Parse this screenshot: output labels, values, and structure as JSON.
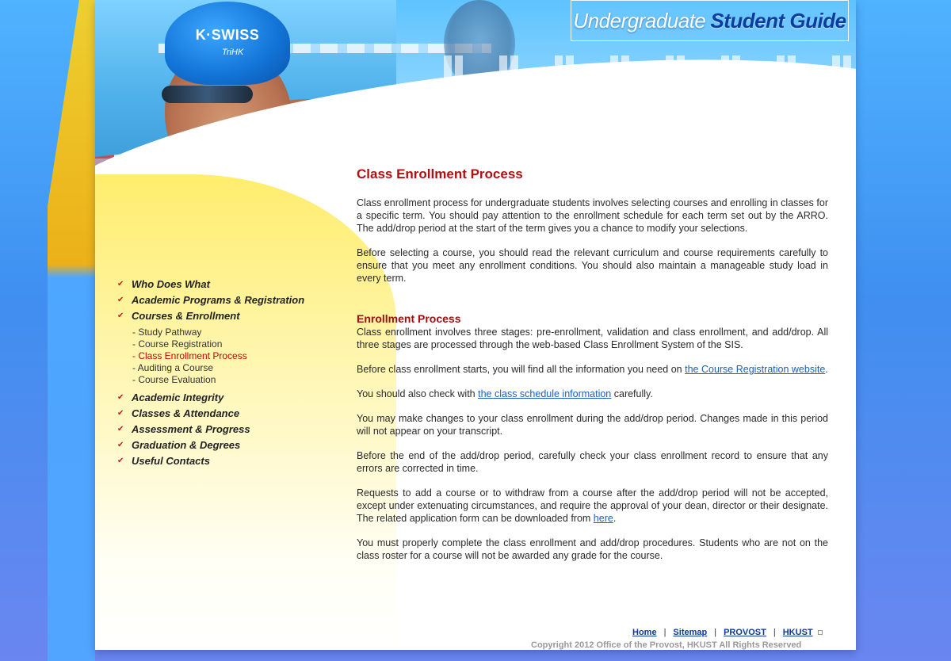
{
  "header": {
    "title_light": "Undergraduate",
    "title_bold": "Student Guide",
    "cap_brand": "K·SWISS",
    "cap_team": "TriHK"
  },
  "nav": {
    "items": [
      {
        "label": "Who Does What"
      },
      {
        "label": "Academic Programs & Registration"
      },
      {
        "label": "Courses & Enrollment"
      },
      {
        "label": "Academic Integrity"
      },
      {
        "label": "Classes & Attendance"
      },
      {
        "label": "Assessment & Progress"
      },
      {
        "label": "Graduation & Degrees"
      },
      {
        "label": "Useful Contacts"
      }
    ],
    "subitems": [
      {
        "label": "- Study Pathway"
      },
      {
        "label": "- Course Registration"
      },
      {
        "label": "- Class Enrollment Process"
      },
      {
        "label": "- Auditing a Course"
      },
      {
        "label": "- Course Evaluation"
      }
    ]
  },
  "content": {
    "title": "Class Enrollment Process",
    "intro1": "Class  enrollment process for undergraduate students involves selecting courses and enrolling in classes for a specific term. You should pay attention to the enrollment schedule for each term set out by the ARRO. The add/drop period at the start of the term gives you a chance to modify your selections.",
    "intro2": "Before selecting a course, you should read the relevant curriculum and course requirements carefully to ensure that you meet any enrollment conditions. You should also maintain a manageable study load in every term.",
    "section_title": "Enrollment Process",
    "p1": "Class enrollment involves three stages: pre-enrollment, validation and class enrollment, and add/drop. All three stages are processed through the web-based Class Enrollment System of the SIS.",
    "p2_before": "Before class enrollment starts, you will find all the information you need on ",
    "p2_link": "the Course Registration website",
    "p2_after": ".",
    "p3_before": "You should also check with ",
    "p3_link": "the class schedule information",
    "p3_after": " carefully.",
    "p4": "You may make changes to your class enrollment during the add/drop period. Changes made in this period will not appear on your transcript.",
    "p5": "Before the end of the add/drop period, carefully check your class enrollment record to ensure that any errors are corrected in time.",
    "p6_before": "Requests to add a course or to withdraw from a course after the add/drop period will not be accepted, except under extenuating circumstances, and require the approval of your dean, director or their designate. The related application form can be downloaded from ",
    "p6_link": "here",
    "p6_after": ".",
    "p7": "You must properly complete the class enrollment and add/drop procedures. Students who are not on the class roster for a course will not be awarded any grade for the course."
  },
  "footer": {
    "links": [
      "Home",
      "Sitemap",
      "PROVOST",
      "HKUST"
    ],
    "separator": "|",
    "copyright": "Copyright 2012 Office of the Provost, HKUST   All Rights Reserved"
  },
  "colors": {
    "heading_red": "#b01010",
    "link_blue": "#1a5fbf",
    "chevron_red": "#cc1a1a",
    "brand_blue": "#0b3c9e"
  }
}
